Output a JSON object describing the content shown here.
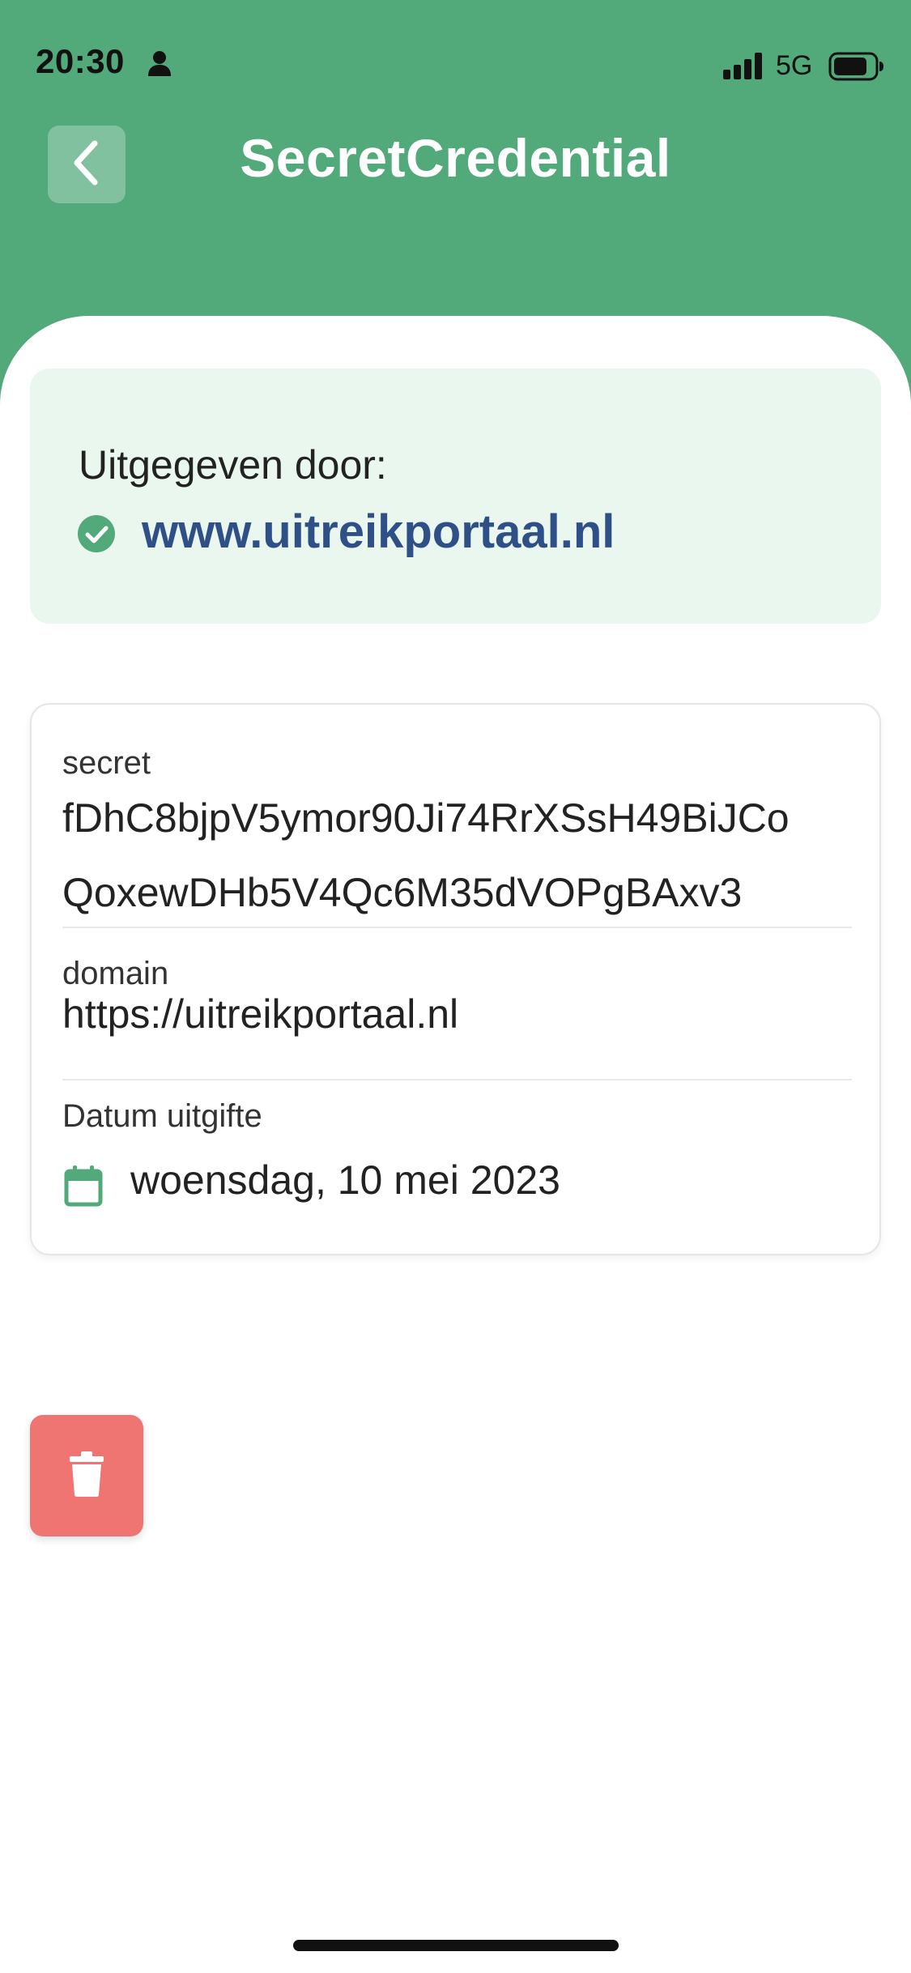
{
  "status_bar": {
    "time": "20:30",
    "network": "5G",
    "icons": [
      "person-icon",
      "signal-bars-icon",
      "battery-icon"
    ]
  },
  "header": {
    "title": "SecretCredential",
    "back_icon": "chevron-left-icon",
    "background_color": "#52a97a"
  },
  "issuer": {
    "label": "Uitgegeven door:",
    "name": "www.uitreikportaal.nl",
    "verified_icon": "check-circle-icon",
    "card_color": "#e9f7ef",
    "link_color": "#2f4f87"
  },
  "attributes": {
    "secret": {
      "label": "secret",
      "value_line1": "fDhC8bjpV5ymor90Ji74RrXSsH49BiJCo",
      "value_line2": "QoxewDHb5V4Qc6M35dVOPgBAxv3"
    },
    "domain": {
      "label": "domain",
      "value": "https://uitreikportaal.nl"
    },
    "issue_date": {
      "label": "Datum uitgifte",
      "value": "woensdag, 10 mei 2023",
      "icon": "calendar-icon"
    }
  },
  "actions": {
    "delete_icon": "trash-icon",
    "delete_color": "#ef7572"
  }
}
